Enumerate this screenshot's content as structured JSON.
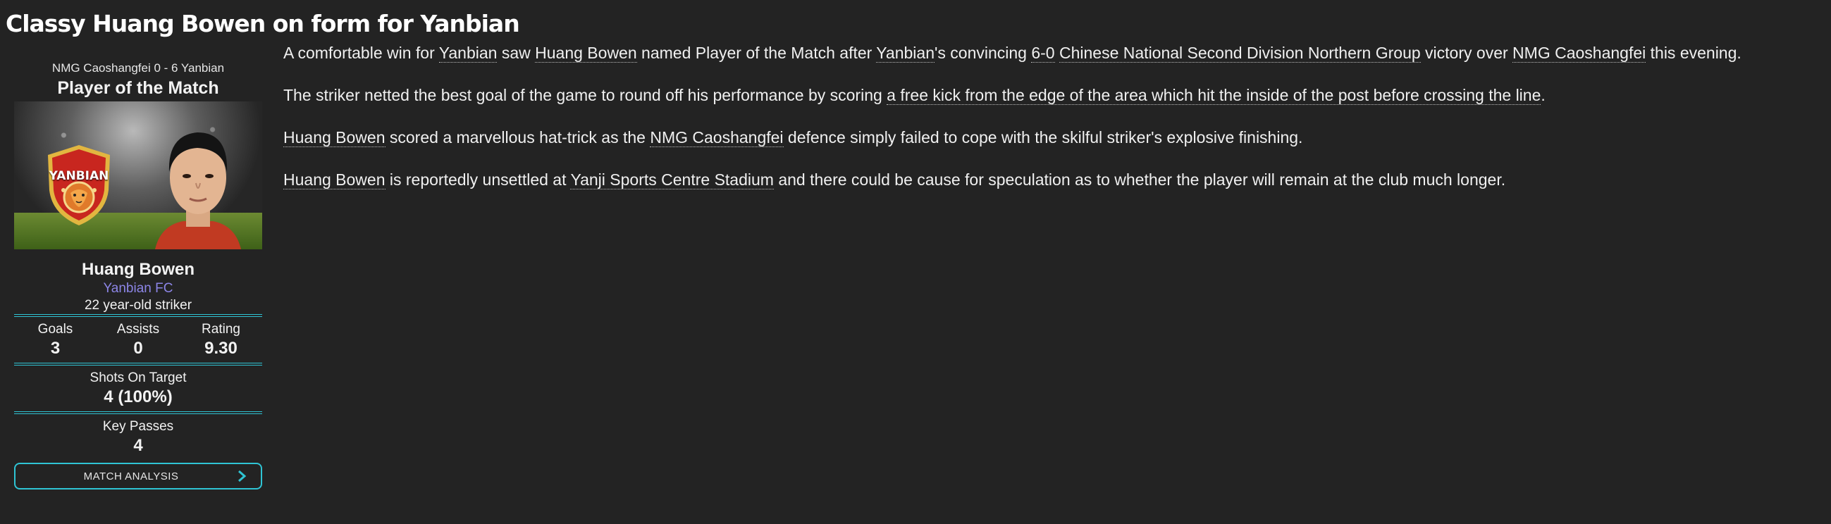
{
  "headline": "Classy Huang Bowen on form for Yanbian",
  "sidebar": {
    "score_line": "NMG Caoshangfei 0 - 6 Yanbian",
    "potm_title": "Player of the Match",
    "crest_text": "YANBIAN",
    "player_name": "Huang Bowen",
    "club": "Yanbian FC",
    "role": "22 year-old striker",
    "stats": {
      "goals_label": "Goals",
      "goals": "3",
      "assists_label": "Assists",
      "assists": "0",
      "rating_label": "Rating",
      "rating": "9.30",
      "shots_label": "Shots On Target",
      "shots": "4 (100%)",
      "passes_label": "Key Passes",
      "passes": "4"
    },
    "button_label": "MATCH ANALYSIS"
  },
  "article": {
    "p1": {
      "a": "A comfortable win for ",
      "l1": "Yanbian",
      "b": " saw ",
      "l2": "Huang Bowen",
      "c": " named Player of the Match after ",
      "l3": "Yanbian",
      "d": "'s convincing ",
      "l4": "6-0",
      "e": " ",
      "l5": "Chinese National Second Division Northern Group",
      "f": " victory over ",
      "l6": "NMG Caoshangfei",
      "g": " this evening."
    },
    "p2": {
      "a": "The striker netted the best goal of the game to round off his performance by scoring ",
      "l1": "a free kick from the edge of the area which hit the inside of the post before crossing the line",
      "b": "."
    },
    "p3": {
      "l1": "Huang Bowen",
      "a": " scored a marvellous hat-trick as the ",
      "l2": "NMG Caoshangfei",
      "b": " defence simply failed to cope with the skilful striker's explosive finishing."
    },
    "p4": {
      "l1": "Huang Bowen",
      "a": " is reportedly unsettled at ",
      "l2": "Yanji Sports Centre Stadium",
      "b": " and there could be cause for speculation as to whether the player will remain at the club much longer."
    }
  },
  "colors": {
    "background": "#232323",
    "accent": "#2fc4d4",
    "club_link": "#8c85e6",
    "crest_red": "#c8261f",
    "crest_gold": "#e2b640"
  },
  "icons": {
    "crest": "yanbian-crest-icon",
    "chevron": "chevron-right-icon"
  }
}
